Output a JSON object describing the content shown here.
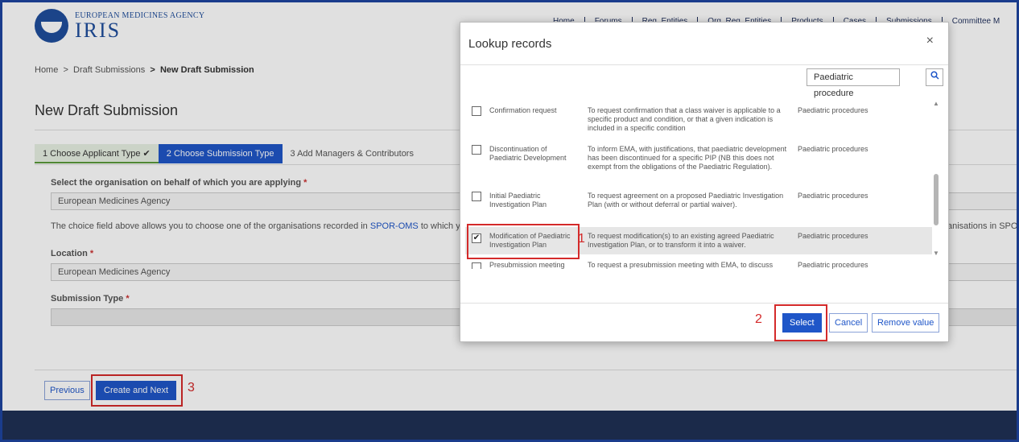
{
  "header": {
    "agency": "EUROPEAN MEDICINES AGENCY",
    "app": "IRIS",
    "nav": [
      "Home",
      "Forums",
      "Reg. Entities",
      "Org. Reg. Entities",
      "Products",
      "Cases",
      "Submissions",
      "Committee M"
    ]
  },
  "breadcrumb": {
    "home": "Home",
    "sep1": ">",
    "drafts": "Draft Submissions",
    "sep2": ">",
    "current": "New Draft Submission"
  },
  "page_title": "New Draft Submission",
  "steps": [
    {
      "label": "1  Choose Applicant Type ✔",
      "state": "done"
    },
    {
      "label": "2  Choose Submission Type",
      "state": "active"
    },
    {
      "label": "3  Add Managers & Contributors",
      "state": "todo"
    }
  ],
  "form": {
    "org_label": "Select the organisation on behalf of which you are applying",
    "org_value": "European Medicines Agency",
    "info_prefix": "The choice field above allows you to choose one of the organisations recorded in ",
    "info_link": "SPOR-OMS",
    "info_suffix": " to which you",
    "info_right": "anisations in SPOR",
    "location_label": "Location",
    "location_value": "European Medicines Agency",
    "subtype_label": "Submission Type",
    "subtype_value": "",
    "required_mark": "*"
  },
  "buttons": {
    "previous": "Previous",
    "create_next": "Create and Next"
  },
  "annotations": {
    "n1": "1",
    "n2": "2",
    "n3": "3"
  },
  "modal": {
    "title": "Lookup records",
    "close": "×",
    "search_value": "Paediatric procedure",
    "search_icon": "search-icon",
    "rows": [
      {
        "checked": false,
        "name": "Confirmation request",
        "desc": "To request confirmation that a class waiver is applicable to a specific product and condition, or that a given indication is included in a specific condition",
        "type": "Paediatric procedures"
      },
      {
        "checked": false,
        "name": "Discontinuation of Paediatric Development",
        "desc": "To inform EMA, with justifications, that paediatric development has been discontinued for a specific PIP (NB this does not exempt from the obligations of the Paediatric Regulation).",
        "type": "Paediatric procedures"
      },
      {
        "checked": false,
        "name": "Initial Paediatric Investigation Plan",
        "desc": "To request agreement on a proposed Paediatric Investigation Plan (with or without deferral or partial waiver).",
        "type": "Paediatric procedures"
      },
      {
        "checked": true,
        "name": "Modification of Paediatric Investigation Plan",
        "desc": "To request modification(s) to an existing agreed Paediatric Investigation Plan, or to transform it into a waiver.",
        "type": "Paediatric procedures"
      },
      {
        "checked": false,
        "name": "Presubmission meeting",
        "desc": "To request a presubmission meeting with EMA, to discuss",
        "type": "Paediatric procedures"
      }
    ],
    "select": "Select",
    "cancel": "Cancel",
    "remove": "Remove value"
  }
}
